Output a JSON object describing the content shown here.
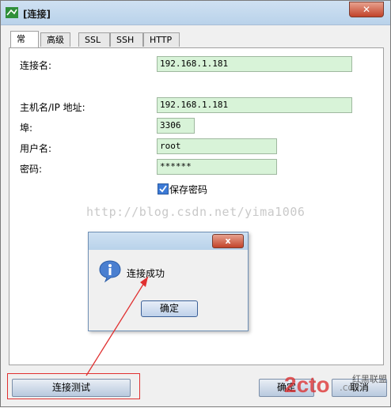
{
  "window": {
    "title": "[连接]"
  },
  "tabs": [
    "常规",
    "高级",
    "SSL",
    "SSH",
    "HTTP"
  ],
  "form": {
    "conn_name_label": "连接名:",
    "conn_name_value": "192.168.1.181",
    "host_label": "主机名/IP 地址:",
    "host_value": "192.168.1.181",
    "port_label": "埠:",
    "port_value": "3306",
    "user_label": "用户名:",
    "user_value": "root",
    "password_label": "密码:",
    "password_value": "******",
    "save_password_label": "保存密码",
    "save_password_checked": true
  },
  "watermark": "http://blog.csdn.net/yima1006",
  "dialog": {
    "close_glyph": "x",
    "message": "连接成功",
    "ok_label": "确定"
  },
  "buttons": {
    "test_connection": "连接测试",
    "ok": "确定",
    "cancel": "取消"
  },
  "brand": {
    "text": "2cto",
    "suffix": ".com",
    "tagline": "红黑联盟"
  },
  "colors": {
    "field_bg": "#d8f3d8",
    "highlight": "#e03030",
    "accent": "#3c7ad6"
  }
}
